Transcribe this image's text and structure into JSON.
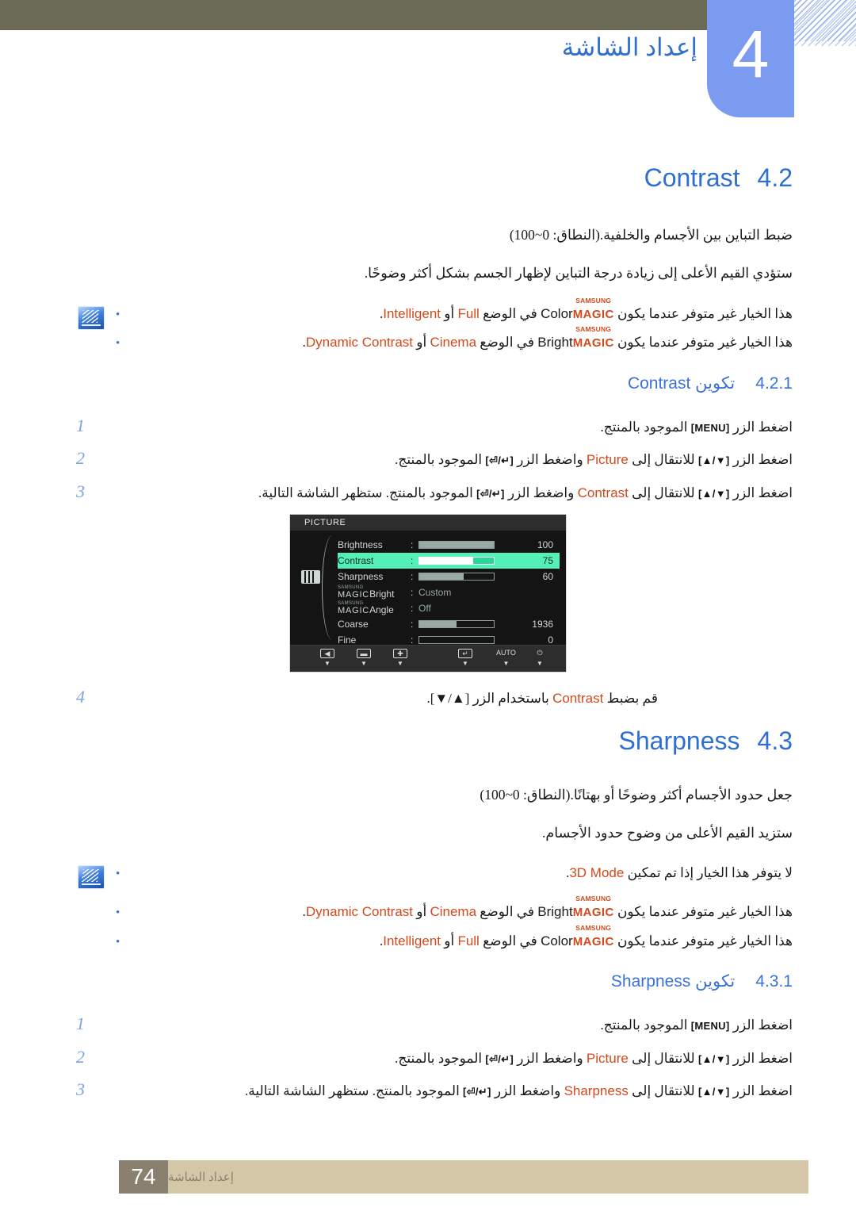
{
  "header": {
    "chapter_number": "4",
    "chapter_title": "إعداد الشاشة"
  },
  "sections": [
    {
      "number": "4.2",
      "name": "Contrast",
      "paragraphs": [
        "ضبط التباين بين الأجسام والخلفية.(النطاق: 0~100)",
        "ستؤدي القيم الأعلى إلى زيادة درجة التباين لإظهار الجسم بشكل أكثر وضوحًا."
      ],
      "notes": [
        {
          "pre": "هذا الخيار غير متوفر عندما يكون",
          "magic_word": "Color",
          "mid": "في الوضع",
          "opt1": "Full",
          "conj": "أو",
          "opt2": "Intelligent",
          "post": "."
        },
        {
          "pre": "هذا الخيار غير متوفر عندما يكون",
          "magic_word": "Bright",
          "mid": "في الوضع",
          "opt1": "Cinema",
          "conj": "أو",
          "opt2": "Dynamic Contrast",
          "post": "."
        }
      ],
      "subsection": {
        "number": "4.2.1",
        "prefix": "تكوين",
        "name": "Contrast"
      },
      "steps": [
        {
          "num": "1",
          "parts": [
            "اضغط الزر",
            "[MENU]",
            "الموجود بالمنتج."
          ]
        },
        {
          "num": "2",
          "target": "Picture",
          "tail": "الموجود بالمنتج."
        },
        {
          "num": "3",
          "target": "Contrast",
          "tail": "الموجود بالمنتج. ستظهر الشاشة التالية."
        }
      ],
      "final_step": {
        "num": "4",
        "pre": "قم بضبط",
        "target": "Contrast",
        "post": "باستخدام الزر [▲/▼]."
      }
    },
    {
      "number": "4.3",
      "name": "Sharpness",
      "paragraphs": [
        "جعل حدود الأجسام أكثر وضوحًا أو بهتانًا.(النطاق: 0~100)",
        "ستزيد القيم الأعلى من وضوح حدود الأجسام."
      ],
      "notes": [
        {
          "pre": "لا يتوفر هذا الخيار إذا تم تمكين",
          "plain_target": "3D Mode",
          "post": "."
        },
        {
          "pre": "هذا الخيار غير متوفر عندما يكون",
          "magic_word": "Bright",
          "mid": "في الوضع",
          "opt1": "Cinema",
          "conj": "أو",
          "opt2": "Dynamic Contrast",
          "post": "."
        },
        {
          "pre": "هذا الخيار غير متوفر عندما يكون",
          "magic_word": "Color",
          "mid": "في الوضع",
          "opt1": "Full",
          "conj": "أو",
          "opt2": "Intelligent",
          "post": "."
        }
      ],
      "subsection": {
        "number": "4.3.1",
        "prefix": "تكوين",
        "name": "Sharpness"
      },
      "steps": [
        {
          "num": "1",
          "parts": [
            "اضغط الزر",
            "[MENU]",
            "الموجود بالمنتج."
          ]
        },
        {
          "num": "2",
          "target": "Picture",
          "tail": "الموجود بالمنتج."
        },
        {
          "num": "3",
          "target": "Sharpness",
          "tail": "الموجود بالمنتج. ستظهر الشاشة التالية."
        }
      ]
    }
  ],
  "common_step_text": {
    "press_button": "اضغط الزر",
    "navigate_to": "للانتقال إلى",
    "and_press": "واضغط الزر",
    "up_down_key": "[▲/▼]",
    "enter_key": "[⏎/↵]",
    "menu_key": "[MENU]"
  },
  "magic_brand": {
    "samsung": "SAMSUNG",
    "magic": "MAGIC"
  },
  "osd": {
    "title": "PICTURE",
    "rows": [
      {
        "label": "Brightness",
        "type": "bar",
        "value": "100",
        "fill_pct": 100
      },
      {
        "label": "Contrast",
        "type": "bar",
        "value": "75",
        "fill_pct": 72,
        "active": true
      },
      {
        "label": "Sharpness",
        "type": "bar",
        "value": "60",
        "fill_pct": 60
      },
      {
        "label_magic": "Bright",
        "type": "text",
        "value": "Custom"
      },
      {
        "label_magic": "Angle",
        "type": "text",
        "value": "Off"
      },
      {
        "label": "Coarse",
        "type": "bar",
        "value": "1936",
        "fill_pct": 50
      },
      {
        "label": "Fine",
        "type": "bar",
        "value": "0",
        "fill_pct": 0
      }
    ],
    "footer_buttons": [
      {
        "icon": "◀",
        "name": "left-arrow"
      },
      {
        "icon": "▬",
        "name": "minus"
      },
      {
        "icon": "✚",
        "name": "plus"
      },
      {
        "icon": "↵",
        "name": "enter"
      },
      {
        "icon": "AUTO",
        "name": "auto"
      },
      {
        "icon": "⏻",
        "name": "power"
      }
    ],
    "accent_color": "#55f0b8",
    "background_color": "#141414"
  },
  "footer": {
    "page_number": "74",
    "text": "إعداد الشاشة"
  }
}
